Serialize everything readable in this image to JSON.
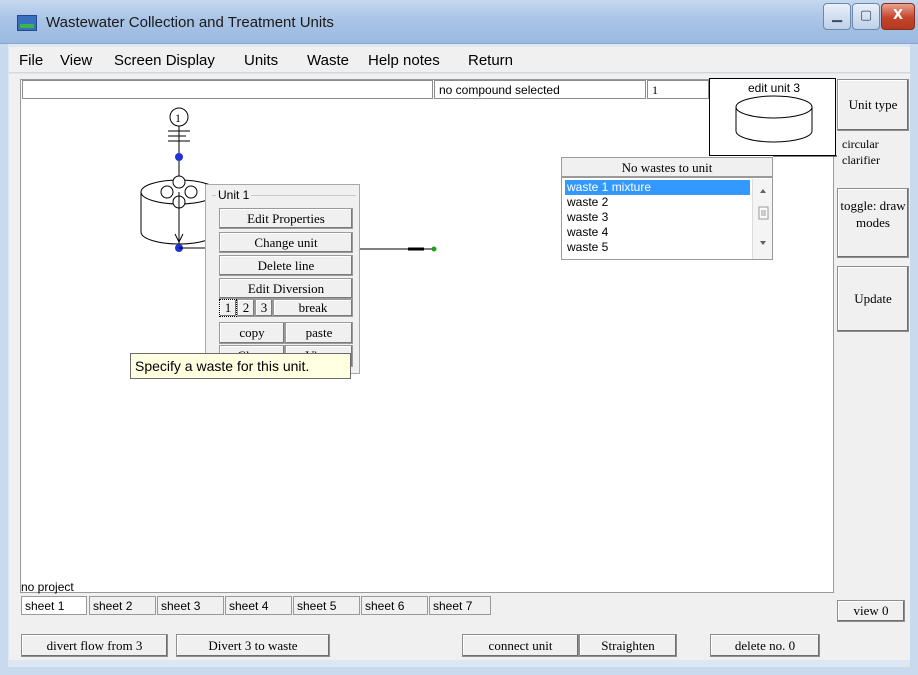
{
  "window": {
    "title": "Wastewater Collection and Treatment Units",
    "min_glyph": "▁",
    "max_glyph": "▢",
    "close_glyph": "X"
  },
  "menu": [
    "File",
    "View",
    "Screen Display",
    "Units",
    "Waste",
    "Help notes",
    "Return"
  ],
  "status": {
    "compound": "no compound selected",
    "number": "1",
    "edit_unit": "edit unit  3"
  },
  "right_panel": {
    "unit_type_label": "Unit type",
    "unit_type_value": "circular clarifier",
    "toggle_label": "toggle: draw modes",
    "update_label": "Update",
    "view_label": "view  0"
  },
  "diagram": {
    "node_label": "1"
  },
  "popup": {
    "title": "Unit  1",
    "edit_properties": "Edit Properties",
    "change_unit": "Change unit",
    "delete_line": "Delete line",
    "edit_diversion": "Edit Diversion",
    "div1": "1",
    "div2": "2",
    "div3": "3",
    "break": "break",
    "copy": "copy",
    "paste": "paste",
    "close": "Close",
    "view": "View"
  },
  "tooltip": "Specify a waste for this unit.",
  "waste_header": "No wastes to unit",
  "wastes": [
    "waste  1 mixture",
    "waste  2",
    "waste  3",
    "waste  4",
    "waste  5"
  ],
  "project": "no project",
  "sheets": [
    "sheet  1",
    "sheet  2",
    "sheet  3",
    "sheet  4",
    "sheet  5",
    "sheet  6",
    "sheet  7"
  ],
  "bottom": {
    "divert_from": "divert flow from  3",
    "divert_waste": "Divert 3 to waste",
    "connect": "connect unit",
    "straighten": "Straighten",
    "delete": "delete no.  0"
  },
  "colors": {
    "node_blue": "#1f33d6",
    "selection": "#3399ff",
    "tooltip_bg": "#ffffe1",
    "flow_green": "#1aa31a"
  }
}
